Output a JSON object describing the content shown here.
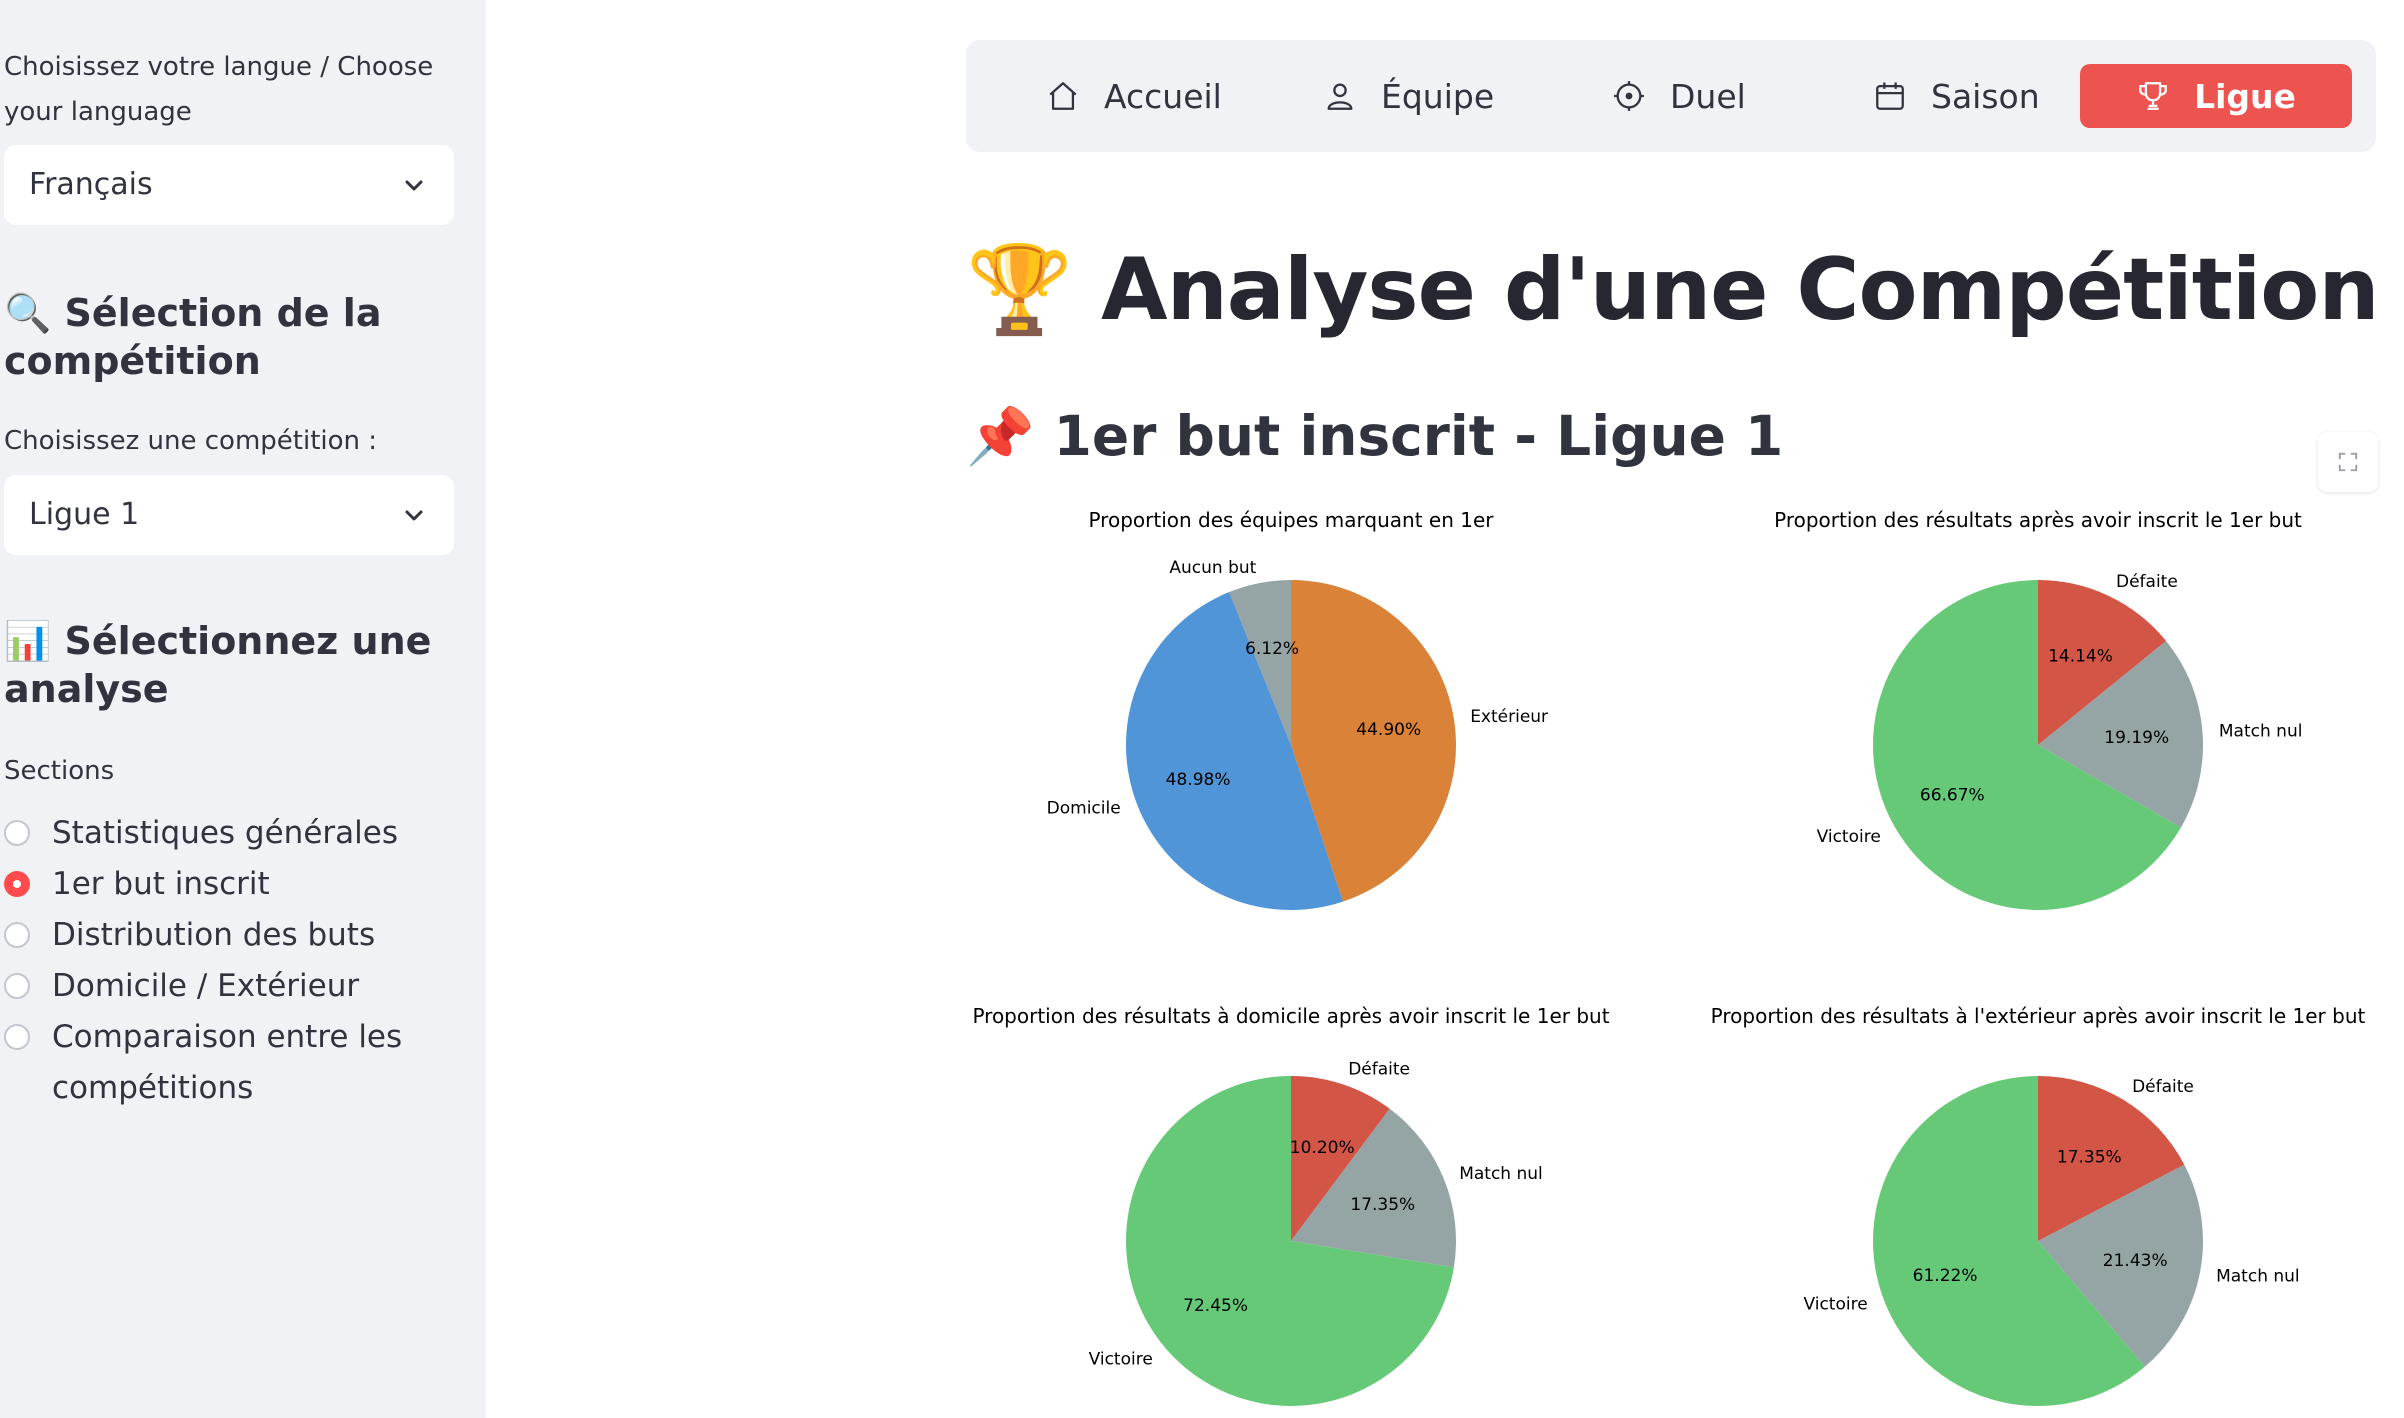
{
  "sidebar": {
    "language_label": "Choisissez votre langue / Choose your language",
    "language_value": "Français",
    "competition_heading": "🔍 Sélection de la compétition",
    "competition_label": "Choisissez une compétition :",
    "competition_value": "Ligue 1",
    "analysis_heading": "📊 Sélectionnez une analyse",
    "sections_label": "Sections",
    "sections": [
      {
        "label": "Statistiques générales",
        "checked": false
      },
      {
        "label": "1er but inscrit",
        "checked": true
      },
      {
        "label": "Distribution des buts",
        "checked": false
      },
      {
        "label": "Domicile / Extérieur",
        "checked": false
      },
      {
        "label": "Comparaison entre les compétitions",
        "checked": false
      }
    ]
  },
  "nav": {
    "items": [
      {
        "label": "Accueil",
        "icon": "home-icon"
      },
      {
        "label": "Équipe",
        "icon": "user-icon"
      },
      {
        "label": "Duel",
        "icon": "target-icon"
      },
      {
        "label": "Saison",
        "icon": "calendar-icon"
      },
      {
        "label": "Ligue",
        "icon": "trophy-icon",
        "active": true
      }
    ],
    "active_color": "#ed5450"
  },
  "main": {
    "title": "🏆 Analyse d'une Compétition",
    "section_title": "📌 1er but inscrit - Ligue 1"
  },
  "colors": {
    "blue": "#4f95d8",
    "orange": "#db8239",
    "gray": "#95a5a5",
    "green": "#66c978",
    "red": "#d35546"
  },
  "chart_data": [
    {
      "type": "pie",
      "title": "Proportion des équipes marquant en 1er",
      "labels": [
        "Extérieur",
        "Domicile",
        "Aucun but"
      ],
      "values": [
        44.9,
        48.98,
        6.12
      ],
      "pct_labels": [
        "44.90%",
        "48.98%",
        "6.12%"
      ],
      "colors": [
        "#db8239",
        "#4f95d8",
        "#95a5a5"
      ]
    },
    {
      "type": "pie",
      "title": "Proportion des résultats après avoir inscrit le 1er but",
      "labels": [
        "Défaite",
        "Match nul",
        "Victoire"
      ],
      "values": [
        14.14,
        19.19,
        66.67
      ],
      "pct_labels": [
        "14.14%",
        "19.19%",
        "66.67%"
      ],
      "colors": [
        "#d35546",
        "#95a5a5",
        "#66c978"
      ]
    },
    {
      "type": "pie",
      "title": "Proportion des résultats à domicile après avoir inscrit le 1er but",
      "labels": [
        "Défaite",
        "Match nul",
        "Victoire"
      ],
      "values": [
        10.2,
        17.35,
        72.45
      ],
      "pct_labels": [
        "10.20%",
        "17.35%",
        "72.45%"
      ],
      "colors": [
        "#d35546",
        "#95a5a5",
        "#66c978"
      ]
    },
    {
      "type": "pie",
      "title": "Proportion des résultats à l'extérieur après avoir inscrit le 1er but",
      "labels": [
        "Défaite",
        "Match nul",
        "Victoire"
      ],
      "values": [
        17.35,
        21.43,
        61.22
      ],
      "pct_labels": [
        "17.35%",
        "21.43%",
        "61.22%"
      ],
      "colors": [
        "#d35546",
        "#95a5a5",
        "#66c978"
      ]
    }
  ]
}
